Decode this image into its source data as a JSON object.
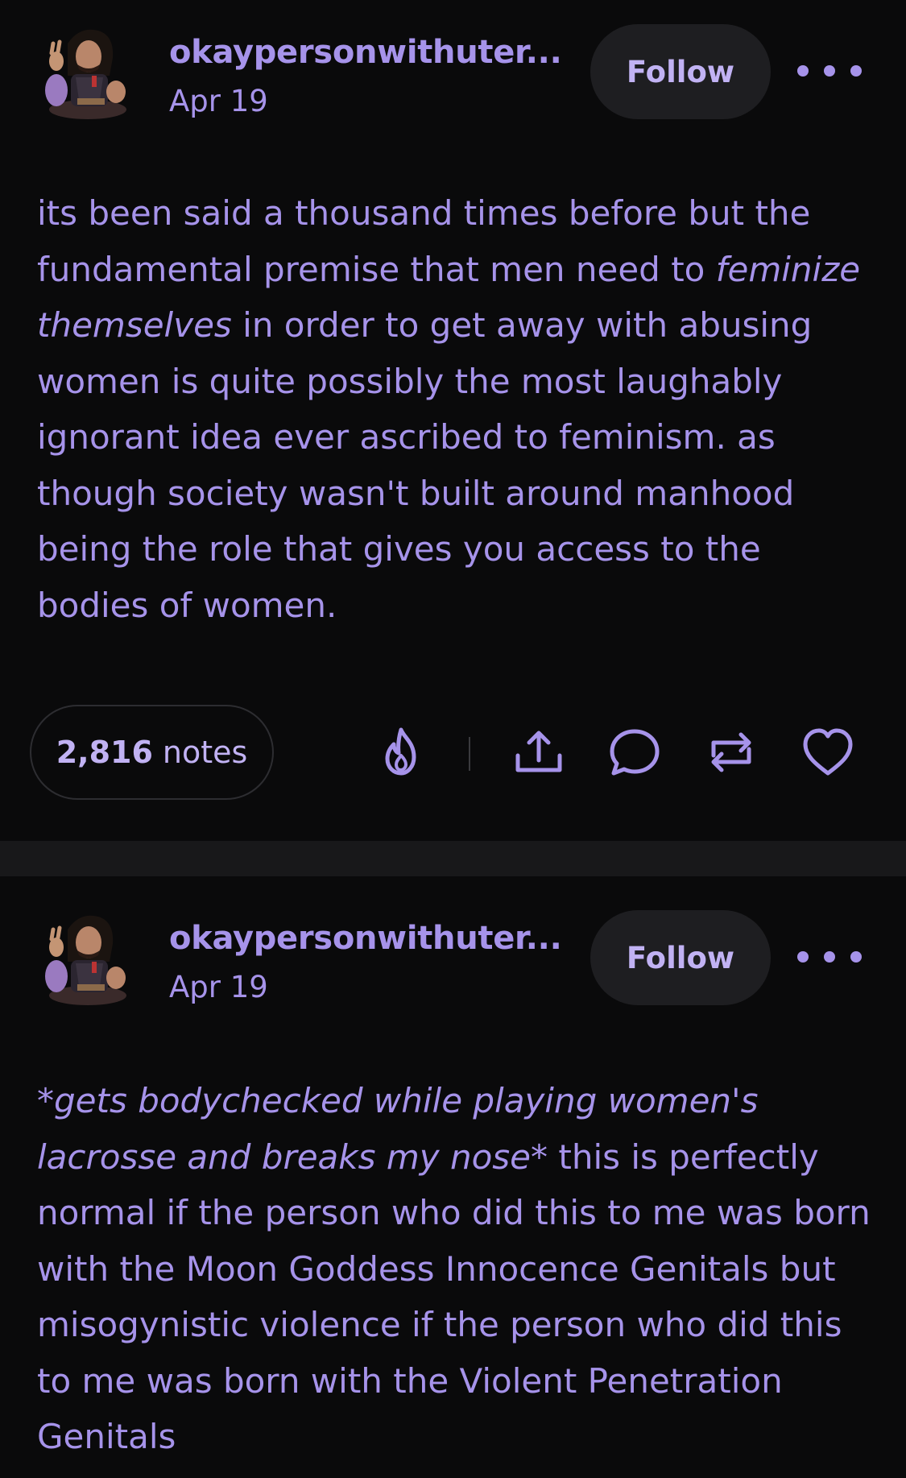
{
  "posts": [
    {
      "username": "okaypersonwithuter...",
      "date": "Apr 19",
      "follow_label": "Follow",
      "body_segments": [
        {
          "text": "its been said a thousand times before but the fundamental premise that men need to ",
          "italic": false
        },
        {
          "text": "feminize themselves",
          "italic": true
        },
        {
          "text": " in order to get away with abusing women is quite possibly the most laughably ignorant idea ever ascribed to feminism. as though society wasn't built around manhood being the role that gives you access to the bodies of women.",
          "italic": false
        }
      ],
      "notes_count": "2,816",
      "notes_label": "notes",
      "actions": [
        "flame-icon",
        "share-icon",
        "comment-icon",
        "reblog-icon",
        "heart-icon"
      ]
    },
    {
      "username": "okaypersonwithuter...",
      "date": "Apr 19",
      "follow_label": "Follow",
      "body_segments": [
        {
          "text": "*",
          "italic": false
        },
        {
          "text": "gets bodychecked while playing women's lacrosse and breaks my nose",
          "italic": true
        },
        {
          "text": "* this is perfectly normal if the person who did this to me was born with the Moon Goddess Innocence Genitals but misogynistic violence if the person who did this to me was born with the Violent Penetration Genitals",
          "italic": false
        }
      ]
    }
  ],
  "colors": {
    "background": "#0a0a0b",
    "accent_text": "#a693ea",
    "button_bg": "#1e1e21",
    "divider": "#18181a"
  }
}
